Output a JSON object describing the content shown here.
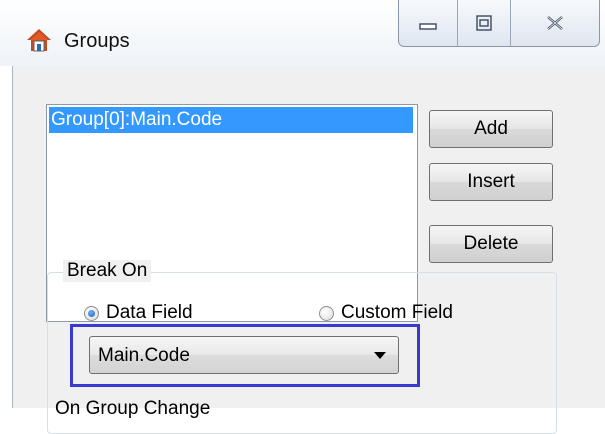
{
  "window": {
    "title": "Groups",
    "icons": {
      "app": "house-icon",
      "minimize": "minimize-icon",
      "maximize": "maximize-icon",
      "close": "close-icon"
    }
  },
  "groups_list": {
    "items": [
      {
        "label": "Group[0]:Main.Code",
        "selected": true
      }
    ]
  },
  "buttons": {
    "add": "Add",
    "insert": "Insert",
    "delete": "Delete"
  },
  "break_on": {
    "label": "Break On",
    "options": [
      {
        "label": "Data Field",
        "selected": true
      },
      {
        "label": "Custom Field",
        "selected": false
      }
    ],
    "field_value": "Main.Code"
  },
  "on_group_change": {
    "label": "On Group Change"
  },
  "colors": {
    "selection": "#3399ff",
    "highlight_border": "#3a3ad0",
    "client_bg": "#f0f0f0"
  }
}
